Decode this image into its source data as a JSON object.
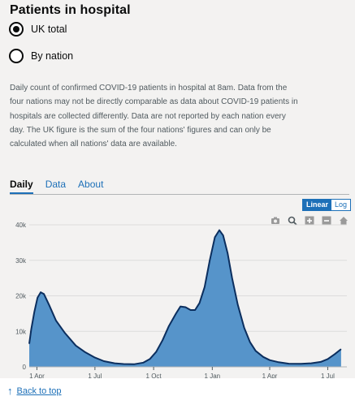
{
  "header": {
    "title": "Patients in hospital"
  },
  "radios": [
    {
      "label": "UK total",
      "checked": true
    },
    {
      "label": "By nation",
      "checked": false
    }
  ],
  "description": "Daily count of confirmed COVID-19 patients in hospital at 8am. Data from the four nations may not be directly comparable as data about COVID-19 patients in hospitals are collected differently. Data are not reported by each nation every day. The UK figure is the sum of the four nations' figures and can only be calculated when all nations' data are available.",
  "tabs": [
    {
      "label": "Daily",
      "active": true
    },
    {
      "label": "Data",
      "active": false
    },
    {
      "label": "About",
      "active": false
    }
  ],
  "scale_toggle": {
    "linear": "Linear",
    "log": "Log",
    "selected": "linear"
  },
  "modebar": [
    "camera-icon",
    "zoom-icon",
    "zoom-in-icon",
    "zoom-out-icon",
    "home-icon"
  ],
  "footer": {
    "back_to_top": "Back to top"
  },
  "colors": {
    "fill": "#5694ca",
    "line": "#0b2e5e",
    "link": "#1d70b8"
  },
  "chart_data": {
    "type": "area",
    "x_start": "2020-03-20",
    "x_end": "2021-07-31",
    "ylim": [
      0,
      40000
    ],
    "yticks": [
      0,
      10000,
      20000,
      30000,
      40000
    ],
    "ytick_labels": [
      "0",
      "10k",
      "20k",
      "30k",
      "40k"
    ],
    "xticks": [
      "2020-04-01",
      "2020-07-01",
      "2020-10-01",
      "2021-01-01",
      "2021-04-01",
      "2021-07-01"
    ],
    "xtick_labels": [
      "1 Apr",
      "1 Jul",
      "1 Oct",
      "1 Jan",
      "1 Apr",
      "1 Jul"
    ],
    "grid": true,
    "series": [
      {
        "name": "",
        "points": [
          [
            "2020-03-20",
            6500
          ],
          [
            "2020-03-23",
            10500
          ],
          [
            "2020-03-28",
            15500
          ],
          [
            "2020-04-02",
            19500
          ],
          [
            "2020-04-07",
            21000
          ],
          [
            "2020-04-12",
            20500
          ],
          [
            "2020-04-20",
            17500
          ],
          [
            "2020-05-01",
            13000
          ],
          [
            "2020-05-15",
            9500
          ],
          [
            "2020-06-01",
            6000
          ],
          [
            "2020-06-15",
            4200
          ],
          [
            "2020-07-01",
            2600
          ],
          [
            "2020-07-15",
            1600
          ],
          [
            "2020-08-01",
            1000
          ],
          [
            "2020-08-15",
            800
          ],
          [
            "2020-09-01",
            750
          ],
          [
            "2020-09-15",
            1200
          ],
          [
            "2020-09-25",
            2200
          ],
          [
            "2020-10-05",
            4200
          ],
          [
            "2020-10-15",
            7500
          ],
          [
            "2020-10-25",
            11500
          ],
          [
            "2020-11-05",
            15000
          ],
          [
            "2020-11-12",
            17000
          ],
          [
            "2020-11-20",
            16800
          ],
          [
            "2020-11-28",
            16000
          ],
          [
            "2020-12-05",
            16000
          ],
          [
            "2020-12-12",
            18000
          ],
          [
            "2020-12-20",
            22500
          ],
          [
            "2020-12-28",
            30000
          ],
          [
            "2021-01-05",
            36500
          ],
          [
            "2021-01-12",
            38500
          ],
          [
            "2021-01-18",
            37000
          ],
          [
            "2021-01-25",
            32000
          ],
          [
            "2021-02-01",
            25000
          ],
          [
            "2021-02-10",
            17500
          ],
          [
            "2021-02-20",
            11000
          ],
          [
            "2021-03-01",
            7000
          ],
          [
            "2021-03-10",
            4500
          ],
          [
            "2021-03-22",
            2800
          ],
          [
            "2021-04-01",
            1900
          ],
          [
            "2021-04-15",
            1300
          ],
          [
            "2021-05-01",
            900
          ],
          [
            "2021-05-20",
            850
          ],
          [
            "2021-06-05",
            1000
          ],
          [
            "2021-06-20",
            1400
          ],
          [
            "2021-07-01",
            2200
          ],
          [
            "2021-07-12",
            3600
          ],
          [
            "2021-07-22",
            5000
          ]
        ]
      }
    ]
  }
}
